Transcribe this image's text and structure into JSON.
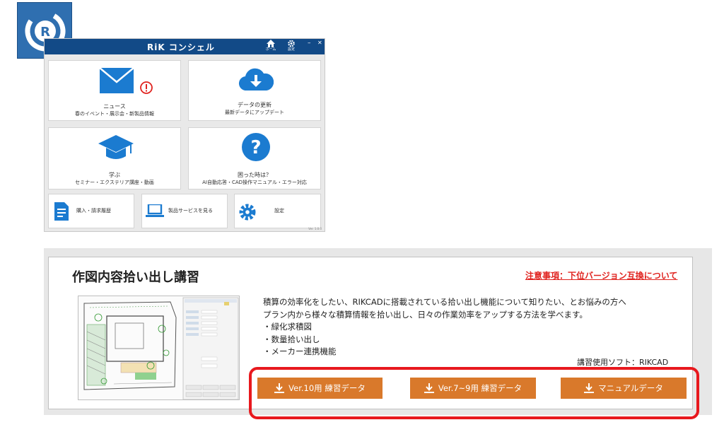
{
  "app": {
    "title": "RiK コンシェル",
    "home_label": "ホーム",
    "settings_label": "設定",
    "minimize_glyph": "–",
    "close_glyph": "✕",
    "tiles": [
      {
        "title": "ニュース",
        "subtitle": "春のイベント・展示会・新製品情報",
        "icon": "mail-icon"
      },
      {
        "title": "データの更新",
        "subtitle": "最新データにアップデート",
        "icon": "cloud-download-icon"
      },
      {
        "title": "学ぶ",
        "subtitle": "セミナー・エクステリア講座・動画",
        "icon": "graduation-cap-icon"
      },
      {
        "title": "困った時は？",
        "subtitle": "AI自動応答・CAD操作マニュアル・エラー対応",
        "icon": "question-icon"
      }
    ],
    "small_tiles": [
      {
        "label": "購入・請求履歴",
        "icon": "document-icon"
      },
      {
        "label": "製品サービスを見る",
        "icon": "laptop-icon"
      },
      {
        "label": "設定",
        "icon": "gear-icon"
      }
    ],
    "version": "Ver. 1.0.0",
    "colors": {
      "titlebar": "#124a87",
      "icon_blue": "#1b7bd0",
      "alert": "#e0231f"
    }
  },
  "lecture": {
    "title": "作図内容拾い出し講習",
    "notice_link": "注意事項：下位バージョン互換について",
    "description": [
      "積算の効率化をしたい、RIKCADに搭載されている拾い出し機能について知りたい、とお悩みの方へ",
      "プラン内から様々な積算情報を拾い出し、日々の作業効率をアップする方法を学べます。",
      "・緑化求積図",
      "・数量拾い出し",
      "・メーカー連携機能"
    ],
    "software": "講習使用ソフト：RIKCAD",
    "buttons": [
      {
        "label": "Ver.10用 練習データ"
      },
      {
        "label": "Ver.7~9用 練習データ"
      },
      {
        "label": "マニュアルデータ"
      }
    ],
    "colors": {
      "button": "#d9792b",
      "highlight": "#e8191e",
      "link": "#e0231f"
    }
  }
}
